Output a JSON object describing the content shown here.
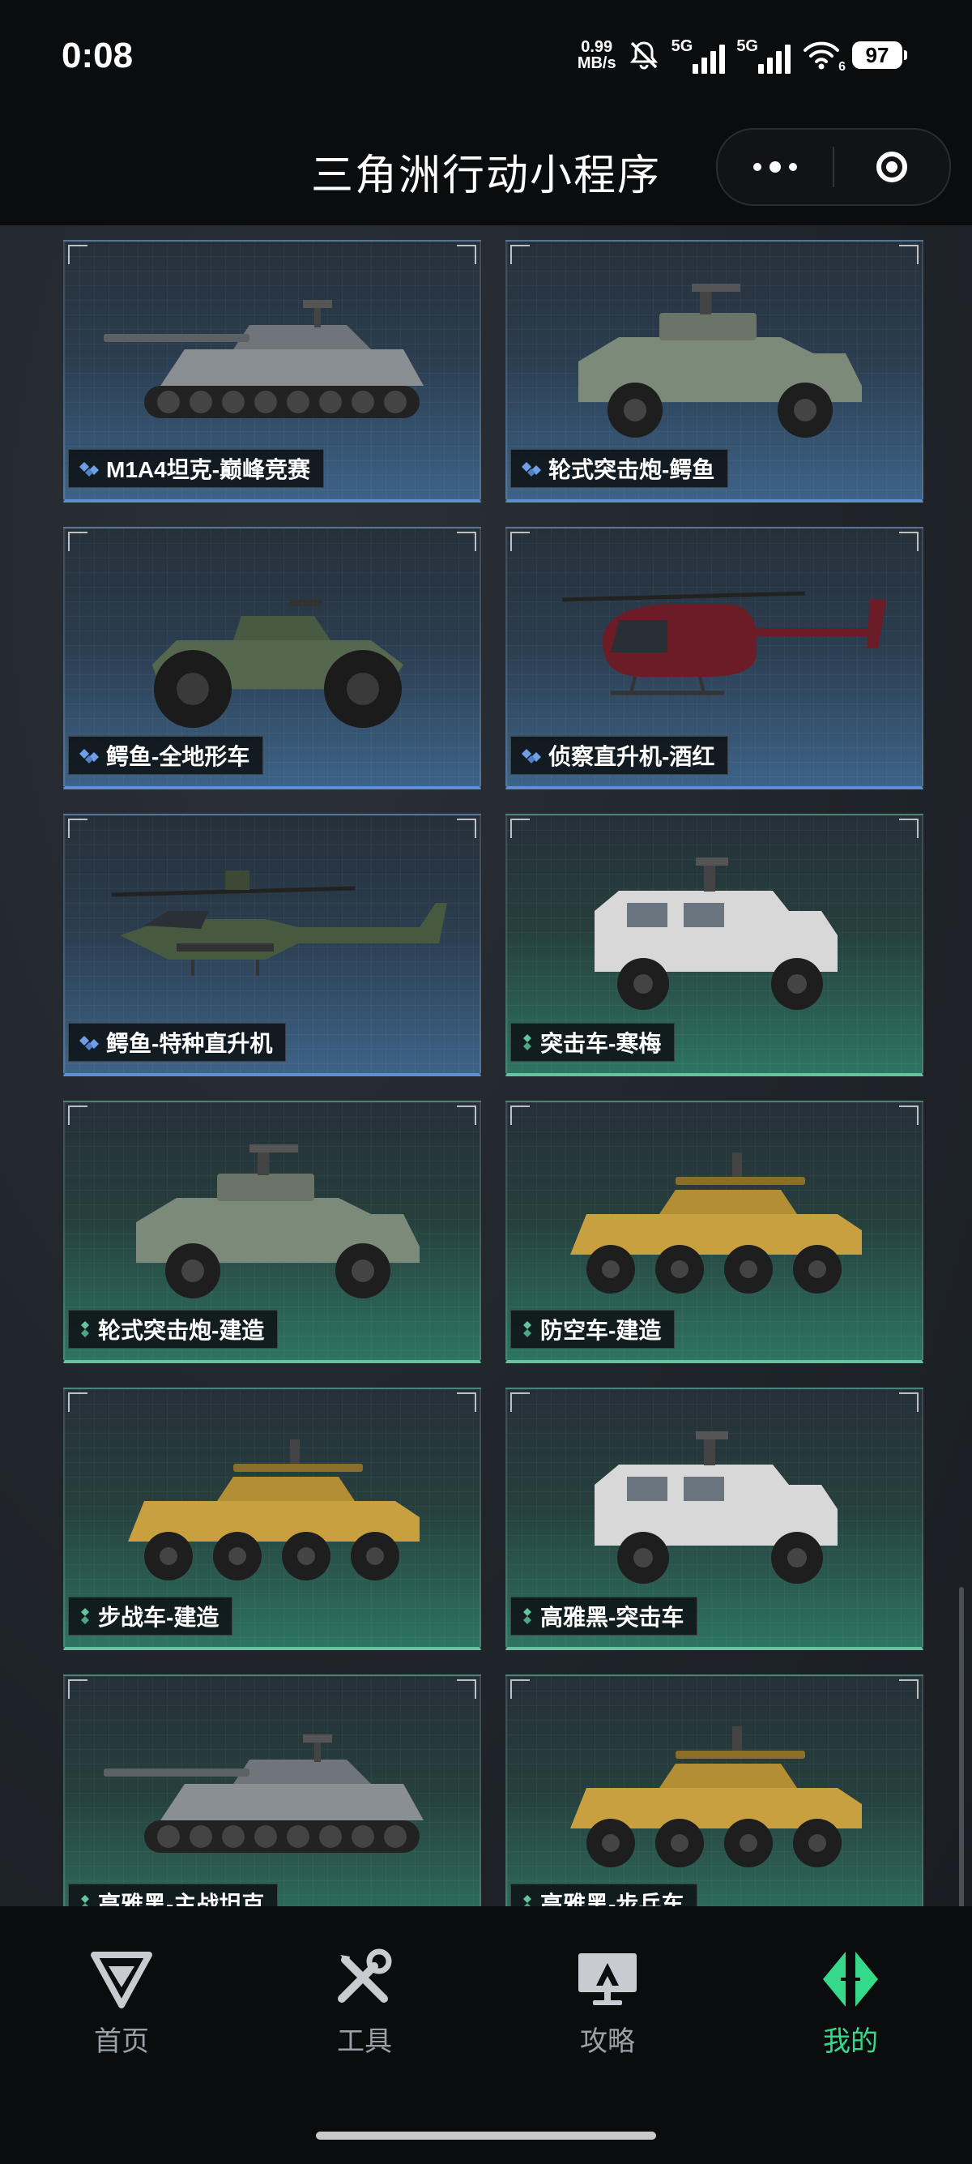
{
  "status_bar": {
    "time": "0:08",
    "net_speed_value": "0.99",
    "net_speed_unit": "MB/s",
    "sim1_label": "5G",
    "sim2_label": "5G",
    "wifi_badge": "6",
    "battery": "97"
  },
  "header": {
    "title": "三角洲行动小程序"
  },
  "vehicles": [
    {
      "label": "M1A4坦克-巅峰竞赛",
      "rarity": "blue",
      "icon": "tank"
    },
    {
      "label": "轮式突击炮-鳄鱼",
      "rarity": "blue",
      "icon": "armored-car"
    },
    {
      "label": "鳄鱼-全地形车",
      "rarity": "blue",
      "icon": "atv"
    },
    {
      "label": "侦察直升机-酒红",
      "rarity": "blue",
      "icon": "scout-helicopter"
    },
    {
      "label": "鳄鱼-特种直升机",
      "rarity": "blue",
      "icon": "attack-helicopter"
    },
    {
      "label": "突击车-寒梅",
      "rarity": "green",
      "icon": "assault-vehicle"
    },
    {
      "label": "轮式突击炮-建造",
      "rarity": "green",
      "icon": "armored-car"
    },
    {
      "label": "防空车-建造",
      "rarity": "green",
      "icon": "ifv"
    },
    {
      "label": "步战车-建造",
      "rarity": "green",
      "icon": "ifv"
    },
    {
      "label": "高雅黑-突击车",
      "rarity": "green",
      "icon": "assault-vehicle"
    },
    {
      "label": "高雅黑-主战坦克",
      "rarity": "green",
      "icon": "tank"
    },
    {
      "label": "高雅黑-步兵车",
      "rarity": "green",
      "icon": "ifv"
    }
  ],
  "bottom_nav": {
    "items": [
      {
        "label": "首页",
        "icon": "delta-logo-icon"
      },
      {
        "label": "工具",
        "icon": "tools-icon"
      },
      {
        "label": "攻略",
        "icon": "guide-monitor-icon"
      },
      {
        "label": "我的",
        "icon": "profile-logo-icon",
        "active": true
      }
    ]
  },
  "colors": {
    "rarity_blue": "#5f8fd2",
    "rarity_green": "#62c5a0",
    "nav_active": "#35d98a",
    "nav_inactive": "#9aa0a6"
  }
}
